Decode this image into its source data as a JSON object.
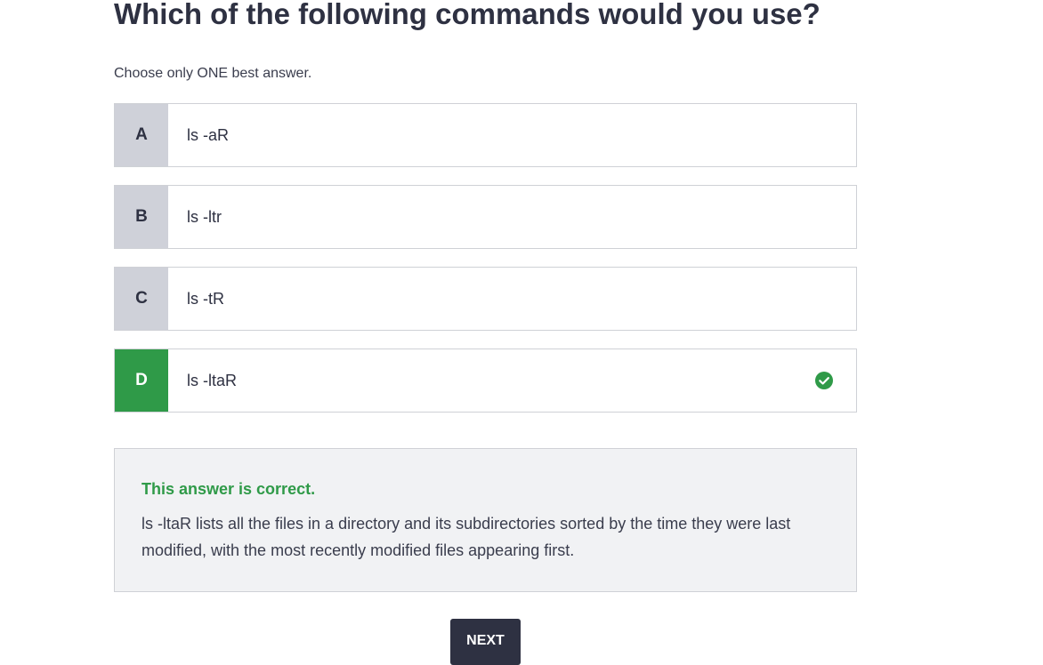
{
  "question": {
    "title": "Which of the following commands would you use?",
    "instruction": "Choose only ONE best answer."
  },
  "options": [
    {
      "letter": "A",
      "text": "ls -aR",
      "state": "default"
    },
    {
      "letter": "B",
      "text": "ls -ltr",
      "state": "default"
    },
    {
      "letter": "C",
      "text": "ls -tR",
      "state": "default"
    },
    {
      "letter": "D",
      "text": "ls -ltaR",
      "state": "correct",
      "icon": "check-circle-icon"
    }
  ],
  "feedback": {
    "verdict": "This answer is correct.",
    "explanation": "ls -ltaR lists all the files in a directory and its subdirectories sorted by the time they were last modified, with the most recently modified files appearing first."
  },
  "actions": {
    "next_label": "NEXT"
  },
  "colors": {
    "correct_green": "#2f9a48",
    "letter_gray": "#cfd1d9",
    "dark_navy": "#2e3142",
    "feedback_bg": "#f1f2f4"
  }
}
